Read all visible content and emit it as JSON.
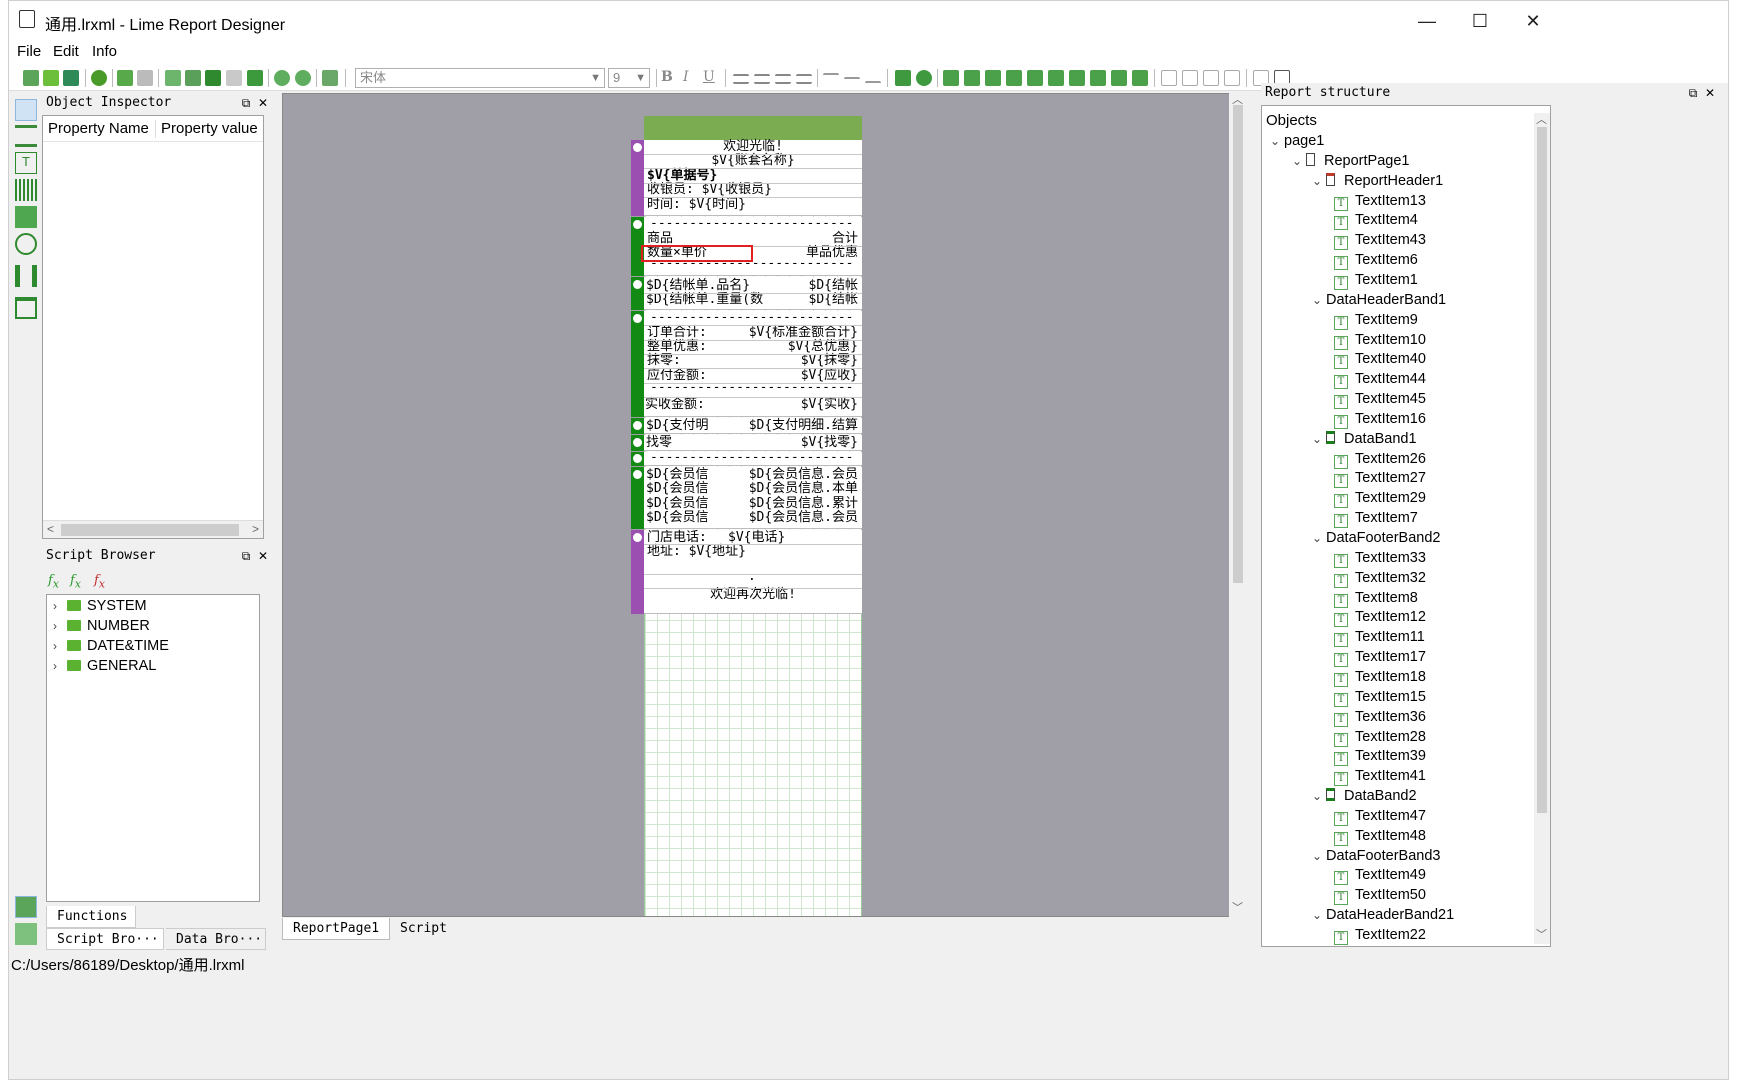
{
  "window": {
    "title": "通用.lrxml - Lime Report Designer",
    "minimize": "—",
    "maximize": "☐",
    "close": "✕"
  },
  "menu": [
    "File",
    "Edit",
    "Info"
  ],
  "toolbar": {
    "font_name": "宋体",
    "font_size": "9",
    "bold": "B",
    "italic": "I",
    "underline": "U"
  },
  "object_inspector": {
    "title": "Object Inspector",
    "col_name": "Property Name",
    "col_value": "Property value"
  },
  "script_browser": {
    "title": "Script Browser",
    "folders": [
      "SYSTEM",
      "NUMBER",
      "DATE&TIME",
      "GENERAL"
    ],
    "tab_functions": "Functions",
    "tab_script_browser": "Script Bro···",
    "tab_data_browser": "Data Bro···"
  },
  "report": {
    "header": [
      "欢迎光临!",
      "$V{账套名称}",
      "$V{单据号}",
      "收银员: $V{收银员}",
      "时间: $V{时间}"
    ],
    "data_header": {
      "dashes": "--------------------------",
      "goods": "商品",
      "total": "合计",
      "qty_price": "数量×单价",
      "discount": "单品优惠"
    },
    "data_band": {
      "left1": "$D{结帐单.品名}",
      "right1": "$D{结帐",
      "left2": "$D{结帐单.重量(数",
      "right2": "$D{结帐"
    },
    "footer": {
      "dashes": "--------------------------",
      "rows": [
        {
          "label": "订单合计:",
          "value": "$V{标准金额合计}"
        },
        {
          "label": "整单优惠:",
          "value": "$V{总优惠}"
        },
        {
          "label": "抹零:",
          "value": "$V{抹零}"
        },
        {
          "label": "应付金额:",
          "value": "$V{应收}"
        }
      ],
      "paid_label": "实收金额:",
      "paid_value": "$V{实收}"
    },
    "payment": {
      "left": "$D{支付明",
      "right": "$D{支付明细.结算"
    },
    "change": {
      "left": "找零",
      "right": "$V{找零}"
    },
    "sep_dashes": "--------------------------",
    "member": [
      {
        "left": "$D{会员信",
        "right": "$D{会员信息.会员"
      },
      {
        "left": "$D{会员信",
        "right": "$D{会员信息.本单"
      },
      {
        "left": "$D{会员信",
        "right": "$D{会员信息.累计"
      },
      {
        "left": "$D{会员信",
        "right": "$D{会员信息.会员"
      }
    ],
    "footer_page": {
      "phone_label": "门店电话:",
      "phone_value": "$V{电话}",
      "address": "地址: $V{地址}",
      "dot": ".",
      "bye": "欢迎再次光临!"
    }
  },
  "bottom_tabs": [
    "ReportPage1",
    "Script"
  ],
  "report_structure": {
    "title": "Report structure",
    "root": "Objects",
    "nodes": [
      {
        "label": "page1",
        "level": 0,
        "kind": "expand"
      },
      {
        "label": "ReportPage1",
        "level": 1,
        "kind": "page"
      },
      {
        "label": "ReportHeader1",
        "level": 2,
        "kind": "band-red"
      },
      {
        "label": "TextItem13",
        "level": 3,
        "kind": "text"
      },
      {
        "label": "TextItem4",
        "level": 3,
        "kind": "text"
      },
      {
        "label": "TextItem43",
        "level": 3,
        "kind": "text"
      },
      {
        "label": "TextItem6",
        "level": 3,
        "kind": "text"
      },
      {
        "label": "TextItem1",
        "level": 3,
        "kind": "text"
      },
      {
        "label": "DataHeaderBand1",
        "level": 2,
        "kind": "plain"
      },
      {
        "label": "TextItem9",
        "level": 3,
        "kind": "text"
      },
      {
        "label": "TextItem10",
        "level": 3,
        "kind": "text"
      },
      {
        "label": "TextItem40",
        "level": 3,
        "kind": "text"
      },
      {
        "label": "TextItem44",
        "level": 3,
        "kind": "text"
      },
      {
        "label": "TextItem45",
        "level": 3,
        "kind": "text"
      },
      {
        "label": "TextItem16",
        "level": 3,
        "kind": "text"
      },
      {
        "label": "DataBand1",
        "level": 2,
        "kind": "band-green"
      },
      {
        "label": "TextItem26",
        "level": 3,
        "kind": "text"
      },
      {
        "label": "TextItem27",
        "level": 3,
        "kind": "text"
      },
      {
        "label": "TextItem29",
        "level": 3,
        "kind": "text"
      },
      {
        "label": "TextItem7",
        "level": 3,
        "kind": "text"
      },
      {
        "label": "DataFooterBand2",
        "level": 2,
        "kind": "plain"
      },
      {
        "label": "TextItem33",
        "level": 3,
        "kind": "text"
      },
      {
        "label": "TextItem32",
        "level": 3,
        "kind": "text"
      },
      {
        "label": "TextItem8",
        "level": 3,
        "kind": "text"
      },
      {
        "label": "TextItem12",
        "level": 3,
        "kind": "text"
      },
      {
        "label": "TextItem11",
        "level": 3,
        "kind": "text"
      },
      {
        "label": "TextItem17",
        "level": 3,
        "kind": "text"
      },
      {
        "label": "TextItem18",
        "level": 3,
        "kind": "text"
      },
      {
        "label": "TextItem15",
        "level": 3,
        "kind": "text"
      },
      {
        "label": "TextItem36",
        "level": 3,
        "kind": "text"
      },
      {
        "label": "TextItem28",
        "level": 3,
        "kind": "text"
      },
      {
        "label": "TextItem39",
        "level": 3,
        "kind": "text"
      },
      {
        "label": "TextItem41",
        "level": 3,
        "kind": "text"
      },
      {
        "label": "DataBand2",
        "level": 2,
        "kind": "band-green"
      },
      {
        "label": "TextItem47",
        "level": 3,
        "kind": "text"
      },
      {
        "label": "TextItem48",
        "level": 3,
        "kind": "text"
      },
      {
        "label": "DataFooterBand3",
        "level": 2,
        "kind": "plain"
      },
      {
        "label": "TextItem49",
        "level": 3,
        "kind": "text"
      },
      {
        "label": "TextItem50",
        "level": 3,
        "kind": "text"
      },
      {
        "label": "DataHeaderBand21",
        "level": 2,
        "kind": "plain"
      },
      {
        "label": "TextItem22",
        "level": 3,
        "kind": "text"
      }
    ]
  },
  "status": "C:/Users/86189/Desktop/通用.lrxml",
  "colors": {
    "band_purple": "#9b4fb0",
    "band_green": "#138a13",
    "page_header_green": "#7bac52",
    "canvas_bg": "#a09ea6",
    "selection_red": "#e02020"
  }
}
